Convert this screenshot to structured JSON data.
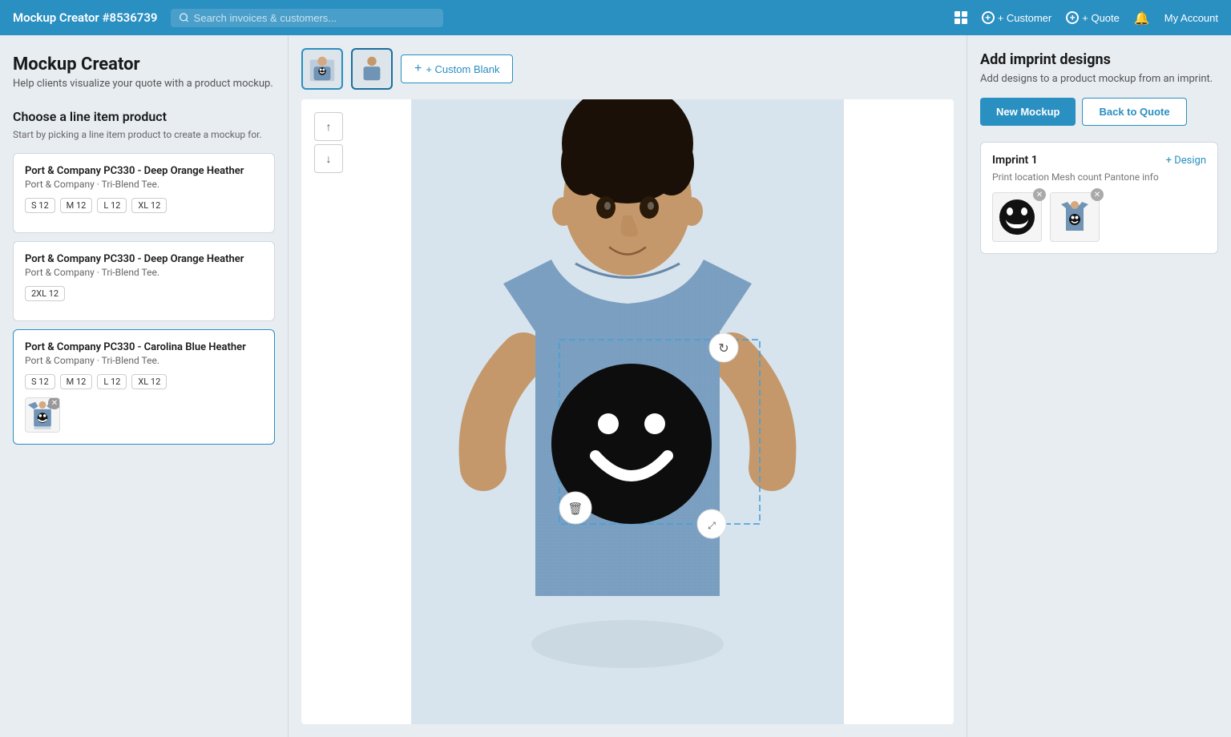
{
  "brand": "Mockup Creator #8536739",
  "search_placeholder": "Search invoices & customers...",
  "nav": {
    "customer_label": "+ Customer",
    "quote_label": "+ Quote",
    "my_account_label": "My Account"
  },
  "page": {
    "title": "Mockup Creator",
    "subtitle": "Help clients visualize your quote with a product mockup."
  },
  "left_panel": {
    "choose_title": "Choose a line item product",
    "choose_hint": "Start by picking a line item product to create a mockup for.",
    "products": [
      {
        "name": "Port & Company PC330 - Deep Orange Heather",
        "sub": "Port & Company · Tri-Blend Tee.",
        "sizes": [
          "S 12",
          "M 12",
          "L 12",
          "XL 12"
        ],
        "has_design": false
      },
      {
        "name": "Port & Company PC330 - Deep Orange Heather",
        "sub": "Port & Company · Tri-Blend Tee.",
        "sizes": [
          "2XL 12"
        ],
        "has_design": false
      },
      {
        "name": "Port & Company PC330 - Carolina Blue Heather",
        "sub": "Port & Company · Tri-Blend Tee.",
        "sizes": [
          "S 12",
          "M 12",
          "L 12",
          "XL 12"
        ],
        "has_design": true
      }
    ]
  },
  "canvas": {
    "custom_blank_label": "+ Custom Blank",
    "arrow_up": "↑",
    "arrow_down": "↓"
  },
  "right_panel": {
    "title": "Add imprint designs",
    "subtitle": "Add designs to a product mockup from an imprint.",
    "new_mockup_label": "New Mockup",
    "back_to_quote_label": "Back to Quote",
    "imprint_title": "Imprint 1",
    "add_design_label": "+ Design",
    "imprint_meta": "Print location  Mesh count  Pantone info"
  },
  "colors": {
    "primary": "#2a8fc1",
    "nav_bg": "#2a8fc1"
  }
}
